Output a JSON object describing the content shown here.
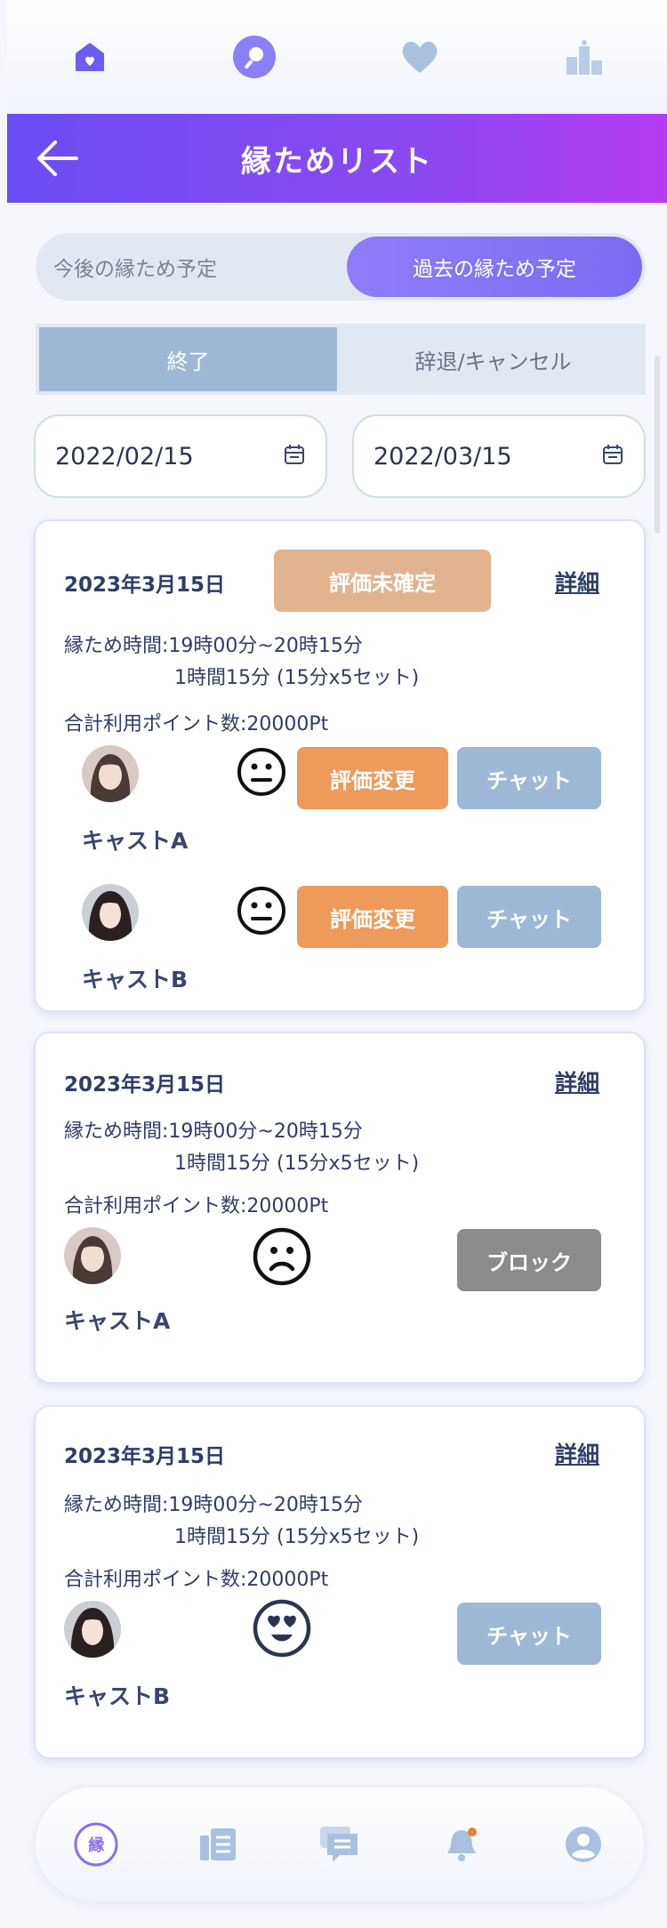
{
  "header": {
    "title": "縁ためリスト"
  },
  "top_icons": [
    "home-icon",
    "magnifier-icon",
    "heart-icon",
    "ranking-icon"
  ],
  "toggle": {
    "left": "今後の縁ため予定",
    "right": "過去の縁ため予定",
    "active": "right"
  },
  "subtabs": {
    "finished": "終了",
    "cancelled": "辞退/キャンセル",
    "active": "finished"
  },
  "dates": {
    "from": "2022/02/15",
    "to": "2022/03/15"
  },
  "cards": [
    {
      "date": "2023年3月15日",
      "badge": "評価未確定",
      "detail": "詳細",
      "time_line": "縁ため時間:19時00分~20時15分",
      "duration_line": "1時間15分 (15分x5セット)",
      "points_line": "合計利用ポイント数:20000Pt",
      "casts": [
        {
          "name": "キャストA",
          "face": "neutral-face-icon",
          "eval_label": "評価変更",
          "chat_label": "チャット"
        },
        {
          "name": "キャストB",
          "face": "neutral-face-icon",
          "eval_label": "評価変更",
          "chat_label": "チャット"
        }
      ]
    },
    {
      "date": "2023年3月15日",
      "detail": "詳細",
      "time_line": "縁ため時間:19時00分~20時15分",
      "duration_line": "1時間15分 (15分x5セット)",
      "points_line": "合計利用ポイント数:20000Pt",
      "casts": [
        {
          "name": "キャストA",
          "face": "sad-face-icon",
          "action_label": "ブロック"
        }
      ]
    },
    {
      "date": "2023年3月15日",
      "detail": "詳細",
      "time_line": "縁ため時間:19時00分~20時15分",
      "duration_line": "1時間15分 (15分x5セット)",
      "points_line": "合計利用ポイント数:20000Pt",
      "casts": [
        {
          "name": "キャストB",
          "face": "heart-eyes-face-icon",
          "action_label": "チャット"
        }
      ]
    }
  ],
  "bottom_nav": {
    "items": [
      "en-logo-icon",
      "list-icon",
      "chat-bubbles-icon",
      "bell-icon",
      "profile-icon"
    ],
    "logo_text": "縁"
  },
  "colors": {
    "header_start": "#6a4cf3",
    "header_end": "#b73cf3",
    "eval_button": "#ee9a5a",
    "chat_button": "#9fb8d6",
    "pending_badge": "#e2b38f",
    "block_button": "#8b8b8b"
  }
}
